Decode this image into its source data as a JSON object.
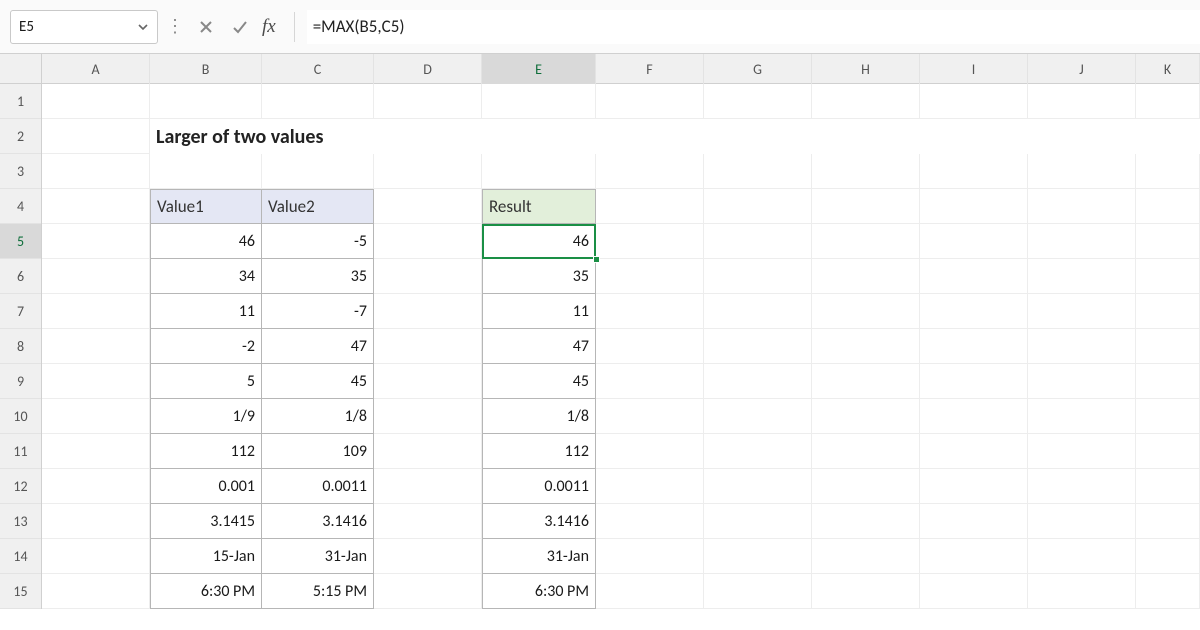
{
  "name_box": {
    "value": "E5"
  },
  "formula_bar": {
    "content": "=MAX(B5,C5)"
  },
  "fx_label": "fx",
  "columns": [
    "A",
    "B",
    "C",
    "D",
    "E",
    "F",
    "G",
    "H",
    "I",
    "J",
    "K"
  ],
  "selected_column": "E",
  "rows": [
    1,
    2,
    3,
    4,
    5,
    6,
    7,
    8,
    9,
    10,
    11,
    12,
    13,
    14,
    15
  ],
  "selected_row": 5,
  "title": "Larger of two values",
  "headers": {
    "value1": "Value1",
    "value2": "Value2",
    "result": "Result"
  },
  "table": [
    {
      "v1": "46",
      "v2": "-5",
      "res": "46"
    },
    {
      "v1": "34",
      "v2": "35",
      "res": "35"
    },
    {
      "v1": "11",
      "v2": "-7",
      "res": "11"
    },
    {
      "v1": "-2",
      "v2": "47",
      "res": "47"
    },
    {
      "v1": "5",
      "v2": "45",
      "res": "45"
    },
    {
      "v1": "1/9",
      "v2": "1/8",
      "res": "1/8"
    },
    {
      "v1": "112",
      "v2": "109",
      "res": "112"
    },
    {
      "v1": "0.001",
      "v2": "0.0011",
      "res": "0.0011"
    },
    {
      "v1": "3.1415",
      "v2": "3.1416",
      "res": "3.1416"
    },
    {
      "v1": "15-Jan",
      "v2": "31-Jan",
      "res": "31-Jan"
    },
    {
      "v1": "6:30 PM",
      "v2": "5:15 PM",
      "res": "6:30 PM"
    }
  ],
  "colors": {
    "selection": "#1a8f45",
    "header_blue": "#e4e7f4",
    "header_green": "#e2efda"
  }
}
